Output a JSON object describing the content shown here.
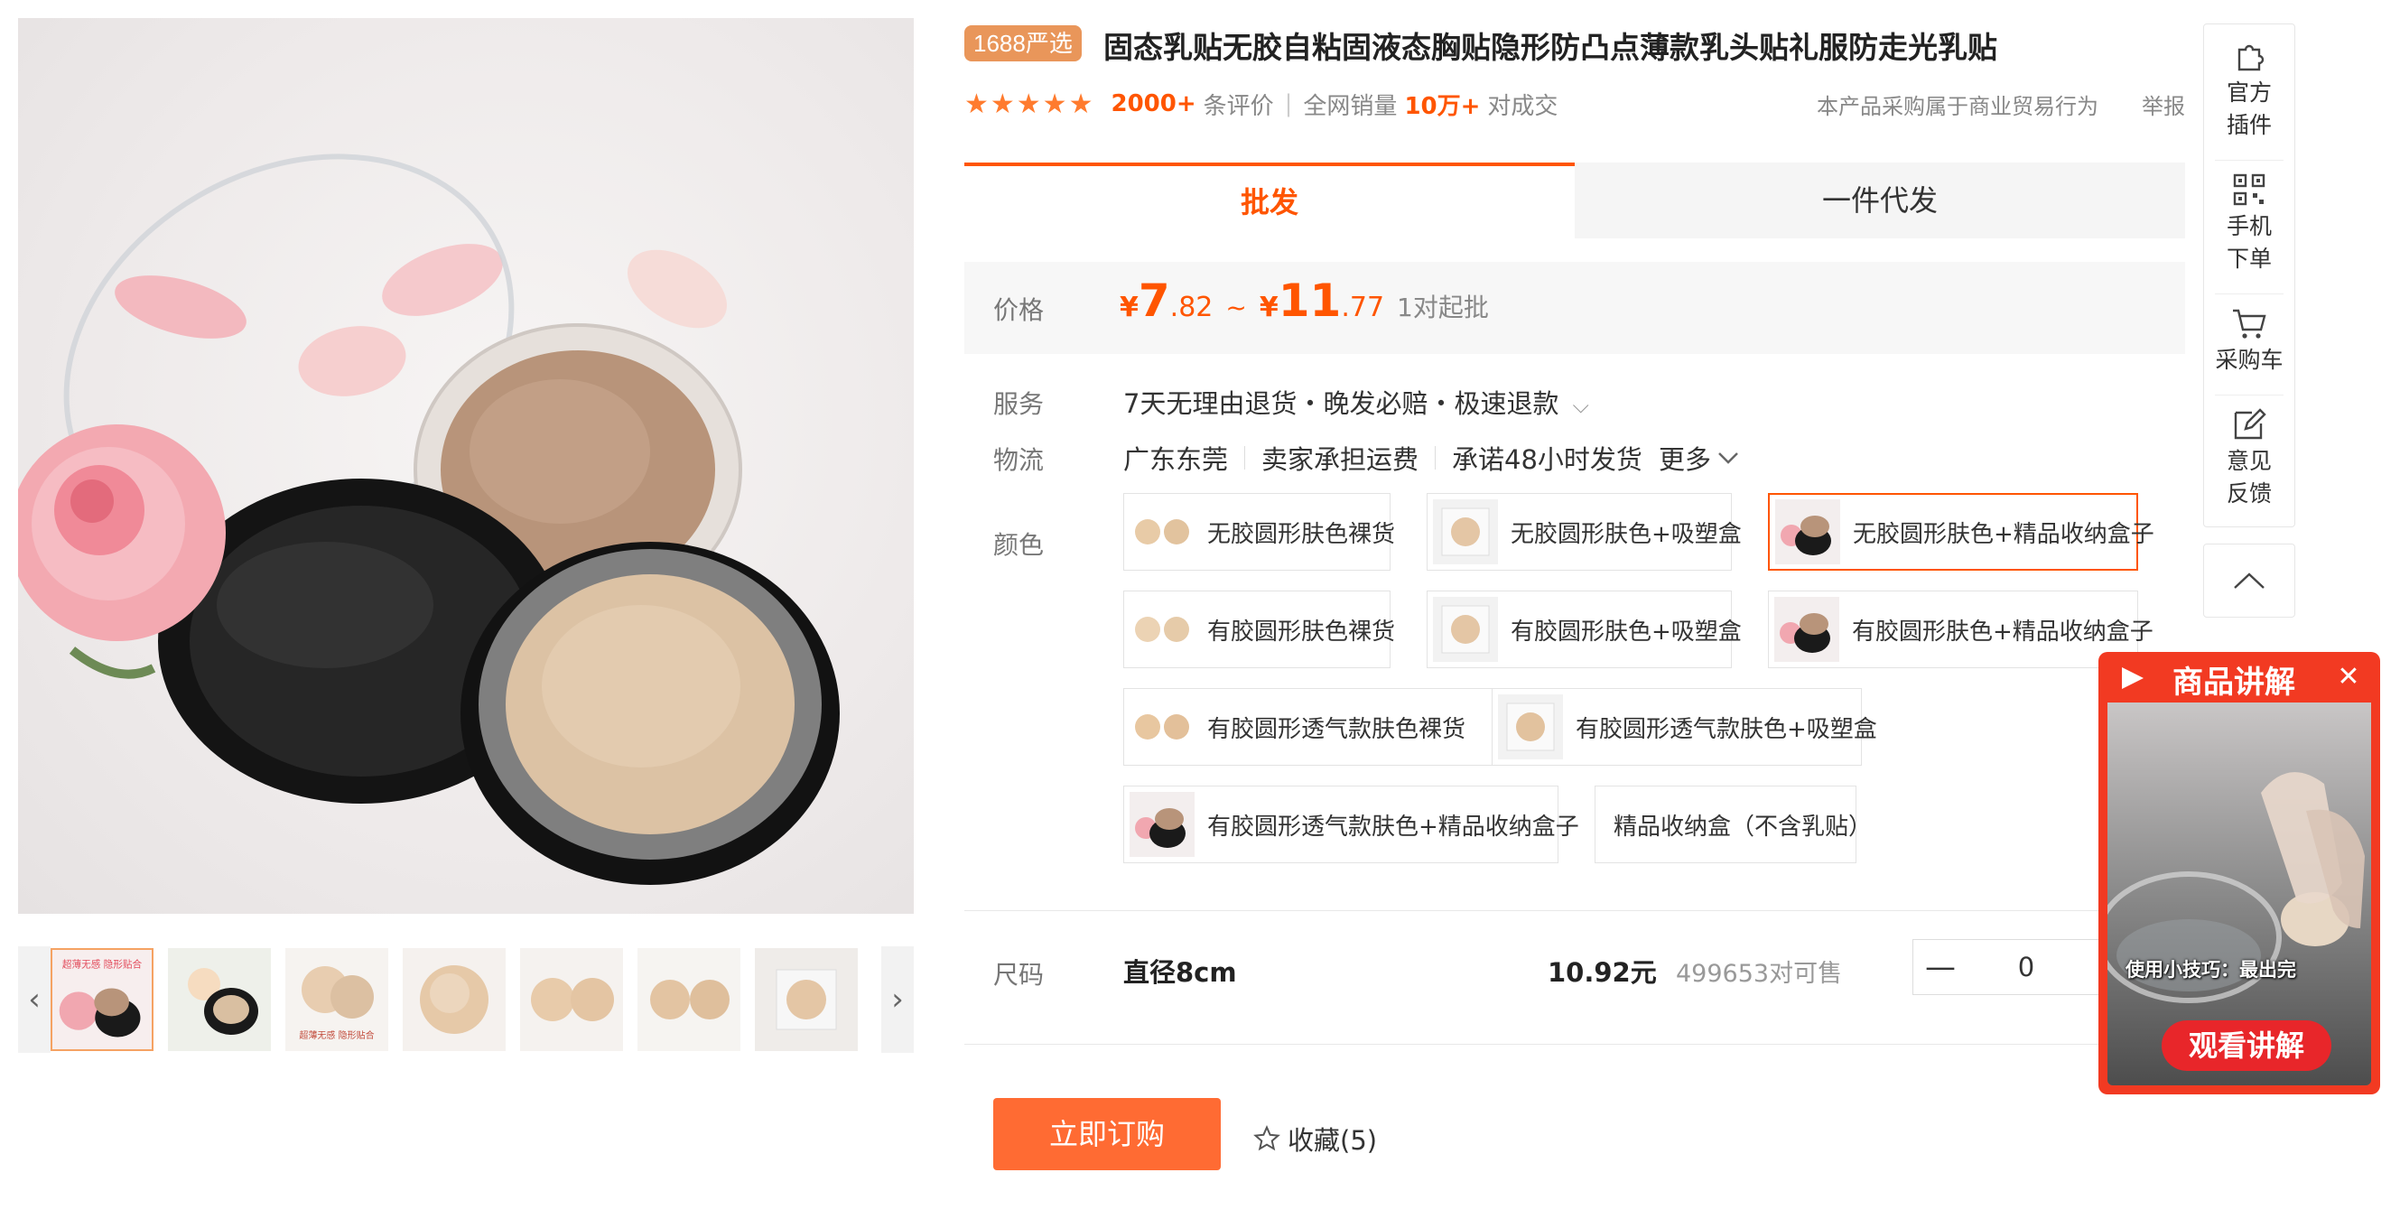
{
  "product": {
    "badge": "1688严选",
    "title": "固态乳贴无胶自粘固液态胸贴隐形防凸点薄款乳头贴礼服防走光乳贴",
    "stars": "★★★★★",
    "review_count": "2000+",
    "review_suffix": "条评价",
    "sales_prefix": "全网销量",
    "sales_count": "10万+",
    "sales_suffix": "对成交",
    "trade_note": "本产品采购属于商业贸易行为",
    "report": "举报"
  },
  "gallery": {
    "prev_icon": "chevron-left-icon",
    "next_icon": "chevron-right-icon",
    "thumb1_text_top": "超薄无感 隐形贴合",
    "thumb3_text_bottom": "超薄无感 隐形贴合"
  },
  "tabs": [
    {
      "label": "批发"
    },
    {
      "label": "一件代发"
    }
  ],
  "price": {
    "label": "价格",
    "symbol": "¥",
    "min_int": "7",
    "min_dec": ".82",
    "tilde": "~",
    "max_int": "11",
    "max_dec": ".77",
    "moq": "1对起批"
  },
  "service": {
    "label": "服务",
    "text": "7天无理由退货・晚发必赔・极速退款",
    "chevron": "⌵"
  },
  "logistics": {
    "label": "物流",
    "origin": "广东东莞",
    "shipping": "卖家承担运费",
    "promise": "承诺48小时发货",
    "more": "更多"
  },
  "color": {
    "label": "颜色",
    "options": [
      {
        "label": "无胶圆形肤色裸货"
      },
      {
        "label": "无胶圆形肤色+吸塑盒"
      },
      {
        "label": "无胶圆形肤色+精品收纳盒子"
      },
      {
        "label": "有胶圆形肤色裸货"
      },
      {
        "label": "有胶圆形肤色+吸塑盒"
      },
      {
        "label": "有胶圆形肤色+精品收纳盒子"
      },
      {
        "label": "有胶圆形透气款肤色裸货"
      },
      {
        "label": "有胶圆形透气款肤色+吸塑盒"
      },
      {
        "label": "有胶圆形透气款肤色+精品收纳盒子"
      },
      {
        "label": "精品收纳盒（不含乳贴）"
      }
    ],
    "selected_index": 2
  },
  "size": {
    "label": "尺码",
    "value": "直径8cm",
    "price": "10.92元",
    "stock": "499653对可售",
    "qty_minus": "—",
    "qty_value": "0"
  },
  "actions": {
    "buy": "立即订购",
    "favorite": "收藏(5)"
  },
  "toolbar": {
    "plugin": [
      "官方",
      "插件"
    ],
    "mobile": [
      "手机",
      "下单"
    ],
    "cart": "采购车",
    "feedback": [
      "意见",
      "反馈"
    ]
  },
  "video": {
    "title": "商品讲解",
    "close": "✕",
    "caption": "使用小技巧：最出完",
    "watch": "观看讲解"
  },
  "colors": {
    "accent": "#ff5500",
    "badge": "#e9965a",
    "video_red": "#f23a22"
  }
}
